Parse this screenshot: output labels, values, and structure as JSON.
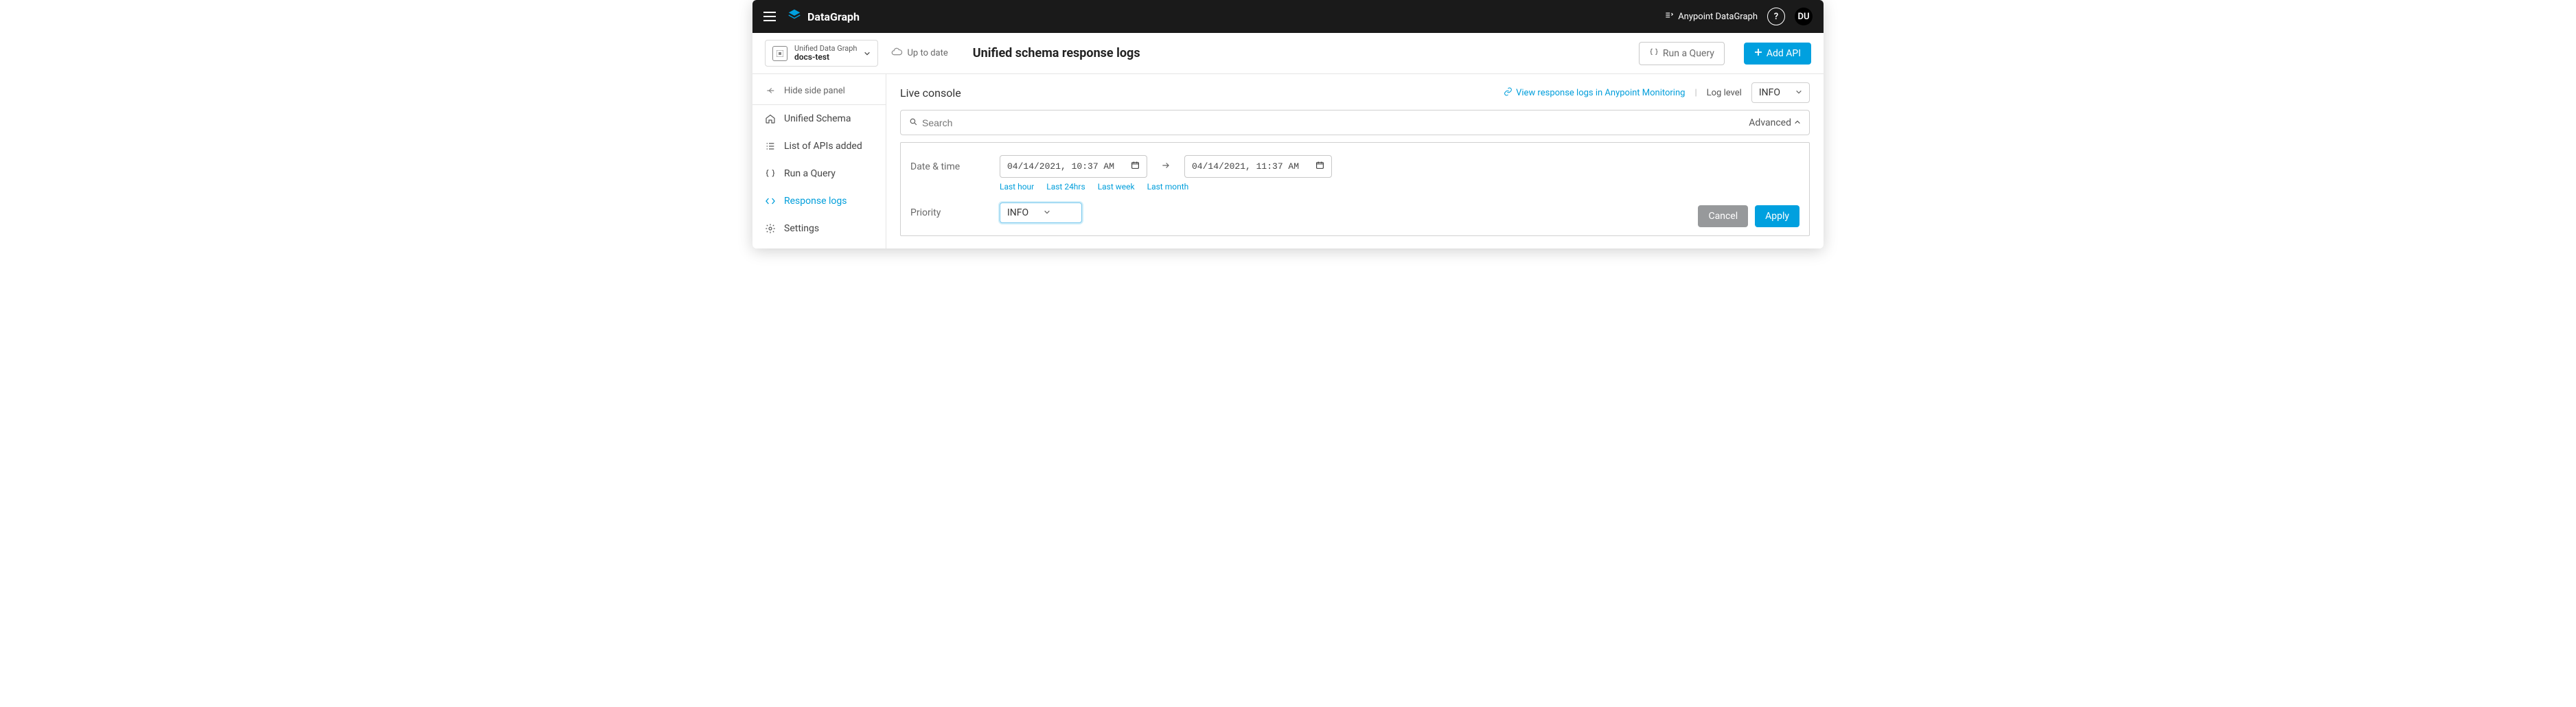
{
  "topbar": {
    "brand": "DataGraph",
    "breadcrumb": "Anypoint DataGraph",
    "help": "?",
    "avatar": "DU"
  },
  "header": {
    "project_top": "Unified Data Graph",
    "project_bottom": "docs-test",
    "cloud_status": "Up to date",
    "page_title": "Unified schema response logs",
    "run_query": "Run a Query",
    "add_api": "Add API"
  },
  "sidebar": {
    "hide": "Hide side panel",
    "items": [
      {
        "label": "Unified Schema"
      },
      {
        "label": "List of APIs added"
      },
      {
        "label": "Run a Query"
      },
      {
        "label": "Response logs"
      },
      {
        "label": "Settings"
      }
    ]
  },
  "console": {
    "title": "Live console",
    "monitoring_link": "View response logs in Anypoint Monitoring",
    "loglevel_label": "Log level",
    "loglevel_value": "INFO",
    "search_placeholder": "Search",
    "advanced": "Advanced",
    "filters": {
      "datetime_label": "Date & time",
      "from": "04/14/2021, 10:37 AM",
      "to": "04/14/2021, 11:37 AM",
      "quick": [
        "Last hour",
        "Last 24hrs",
        "Last week",
        "Last month"
      ],
      "priority_label": "Priority",
      "priority_value": "INFO",
      "cancel": "Cancel",
      "apply": "Apply"
    }
  }
}
